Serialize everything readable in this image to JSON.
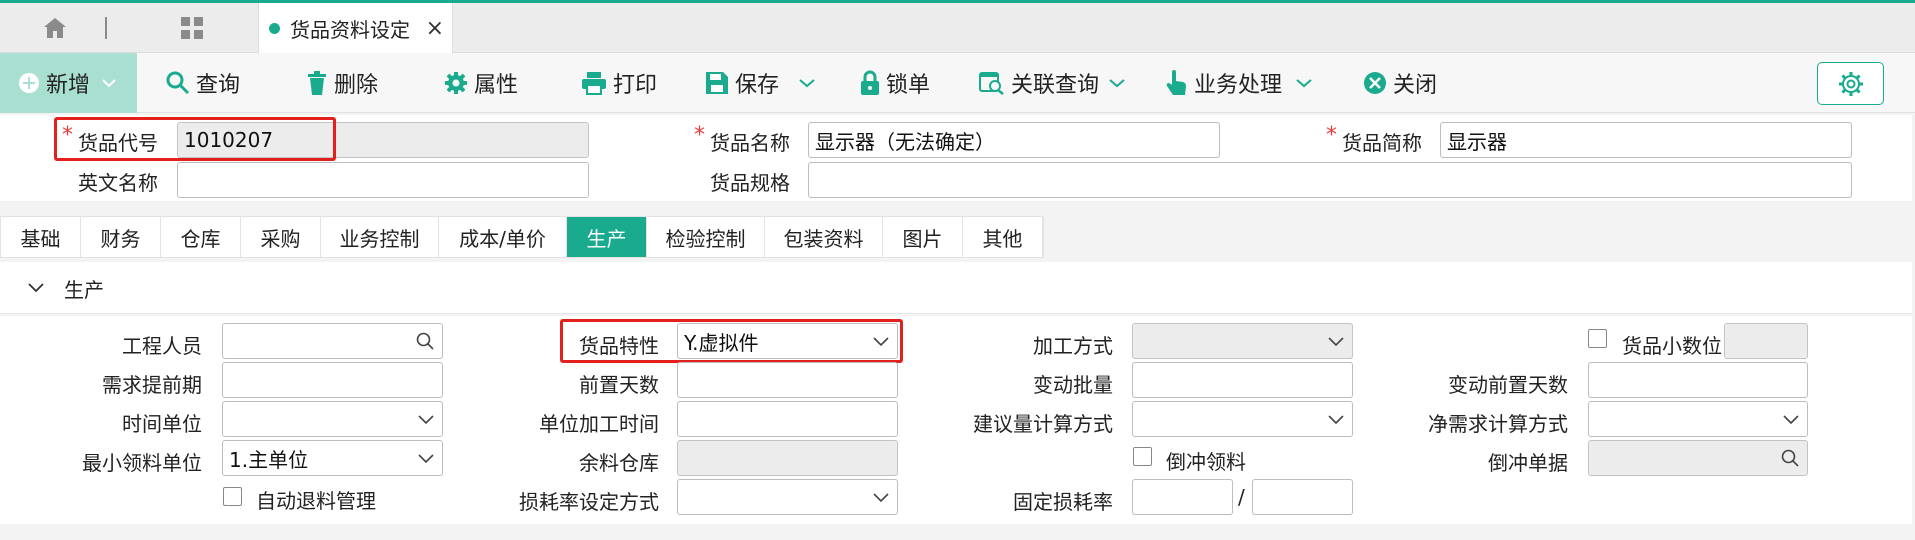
{
  "tabbar": {
    "home_icon": "home-icon",
    "grid_icon": "grid-icon",
    "tab_title": "货品资料设定",
    "tab_close": "×"
  },
  "toolbar": {
    "new": "新增",
    "query": "查询",
    "delete": "删除",
    "attr": "属性",
    "print": "打印",
    "save": "保存",
    "lock": "锁单",
    "related": "关联查询",
    "business": "业务处理",
    "close": "关闭"
  },
  "header": {
    "code_label": "货品代号",
    "code_value": "1010207",
    "name_label": "货品名称",
    "name_value": "显示器（无法确定）",
    "short_label": "货品简称",
    "short_value": "显示器",
    "en_label": "英文名称",
    "en_value": "",
    "spec_label": "货品规格",
    "spec_value": "",
    "required_mark": "*"
  },
  "tabs": [
    "基础",
    "财务",
    "仓库",
    "采购",
    "业务控制",
    "成本/单价",
    "生产",
    "检验控制",
    "包装资料",
    "图片",
    "其他"
  ],
  "active_tab": "生产",
  "section": {
    "title": "生产"
  },
  "form": {
    "engineer_label": "工程人员",
    "engineer_value": "",
    "demand_lead_label": "需求提前期",
    "time_unit_label": "时间单位",
    "time_unit_value": "",
    "min_issue_unit_label": "最小领料单位",
    "min_issue_unit_value": "1.主单位",
    "auto_return_label": "自动退料管理",
    "auto_return_checked": false,
    "feature_label": "货品特性",
    "feature_value": "Y.虚拟件",
    "lead_days_label": "前置天数",
    "unit_time_label": "单位加工时间",
    "surplus_wh_label": "余料仓库",
    "loss_method_label": "损耗率设定方式",
    "loss_method_value": "",
    "process_label": "加工方式",
    "process_value": "",
    "var_batch_label": "变动批量",
    "suggest_calc_label": "建议量计算方式",
    "suggest_calc_value": "",
    "backflush_label": "倒冲领料",
    "backflush_checked": false,
    "fixed_loss_label": "固定损耗率",
    "fixed_loss_sep": "/",
    "decimal_label": "货品小数位",
    "decimal_checked": false,
    "var_lead_days_label": "变动前置天数",
    "net_calc_label": "净需求计算方式",
    "net_calc_value": "",
    "backflush_doc_label": "倒冲单据",
    "backflush_doc_value": ""
  },
  "colors": {
    "accent": "#1aaa8e",
    "highlight": "#e4201c",
    "required": "#e84040"
  }
}
